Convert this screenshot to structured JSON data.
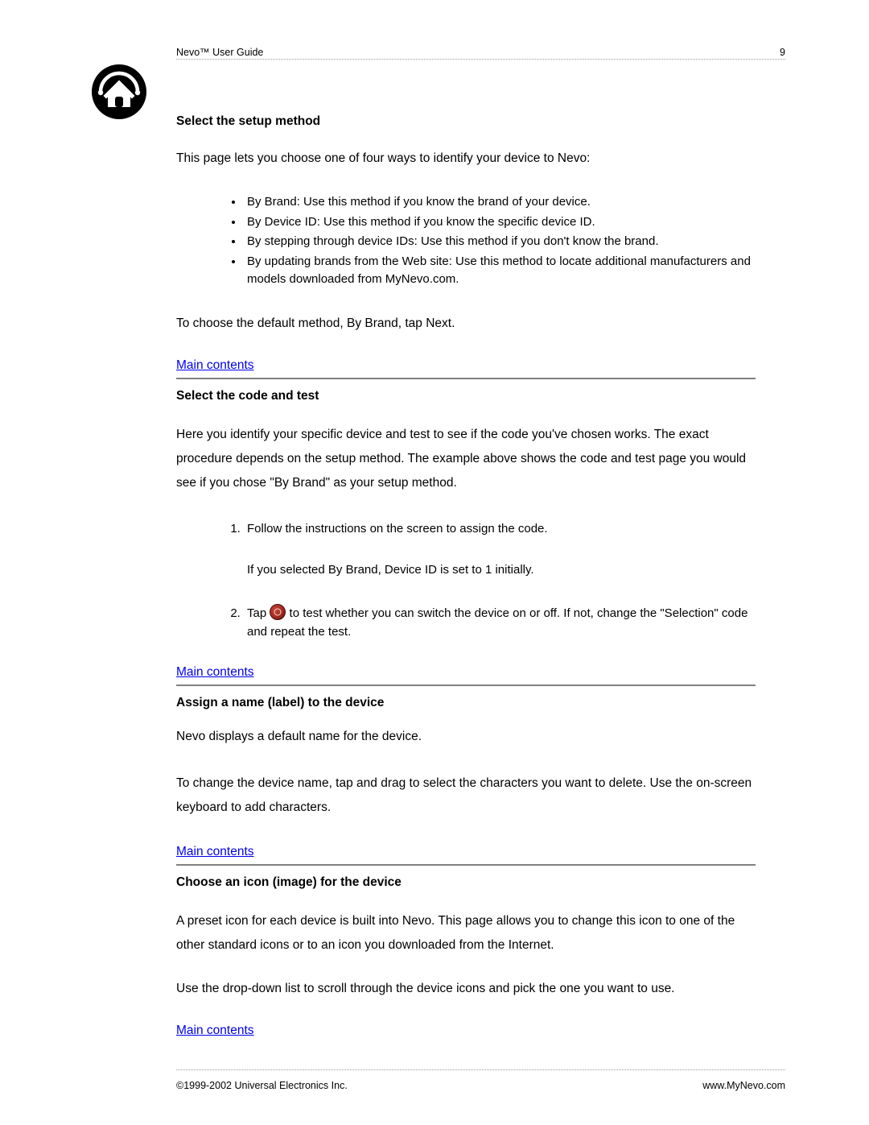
{
  "header": {
    "title": "Nevo™ User Guide",
    "page_number": "9"
  },
  "sections": {
    "s1": {
      "heading": "Select the setup method",
      "intro": "This page lets you choose one of four ways to identify your device to Nevo:",
      "bullets": [
        "By Brand: Use this method if you know the brand of your device.",
        "By Device ID: Use this method if you know the specific device ID.",
        "By stepping through device IDs: Use this method if you don't know the brand.",
        "By updating brands from the Web site: Use this method to locate additional manufacturers and models downloaded from MyNevo.com."
      ],
      "outro": "To choose the default method, By Brand, tap Next.",
      "link": "Main contents"
    },
    "s2": {
      "heading": "Select the code and test",
      "intro": "Here you identify your specific device and test to see if the code you've chosen works. The exact procedure depends on the setup method. The example above shows the code and test page you would see if you chose \"By Brand\" as your setup method.",
      "step1": "Follow the instructions on the screen to assign the code.",
      "step1_sub": "If you selected By Brand, Device ID is set to 1 initially.",
      "step2_pre": "Tap ",
      "step2_post": " to test whether you can switch the device on or off. If not, change the \"Selection\" code and repeat the test.",
      "link": "Main contents"
    },
    "s3": {
      "heading": "Assign a name (label) to the device",
      "p1": "Nevo displays a default name for the device.",
      "p2": "To change the device name, tap and drag to select the characters you want to delete. Use the on-screen keyboard to add characters.",
      "link": "Main contents"
    },
    "s4": {
      "heading": "Choose an icon (image) for the device",
      "p1": "A preset icon for each device is built into Nevo. This page allows you to change this icon to one of the other standard icons or to an icon you downloaded from the Internet.",
      "p2": "Use the drop-down list to scroll through the device icons and pick the one you want to use.",
      "link": "Main contents"
    }
  },
  "footer": {
    "copyright": "©1999-2002 Universal Electronics Inc.",
    "url": "www.MyNevo.com"
  }
}
